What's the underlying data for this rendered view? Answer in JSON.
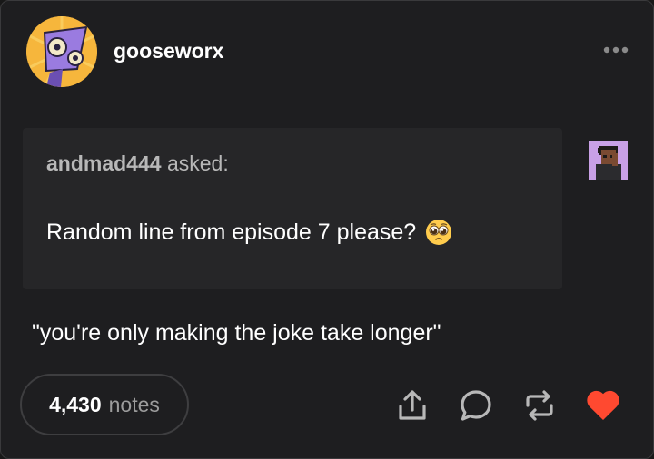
{
  "post": {
    "blog_name": "gooseworx",
    "asker": {
      "name": "andmad444",
      "asked_label": "asked:"
    },
    "question": "Random line from episode 7 please?",
    "question_emoji": "pleading-face-emoji",
    "answer": "\"you're only making the joke take longer\"",
    "notes": {
      "count": "4,430",
      "label": "notes"
    }
  },
  "icons": {
    "menu": "more-horizontal-icon",
    "share": "share-icon",
    "reply": "reply-icon",
    "reblog": "reblog-icon",
    "like": "heart-icon"
  },
  "colors": {
    "background": "#1e1e20",
    "ask_box": "#262628",
    "like": "#ff4930",
    "muted_text": "#b8b8b8"
  }
}
